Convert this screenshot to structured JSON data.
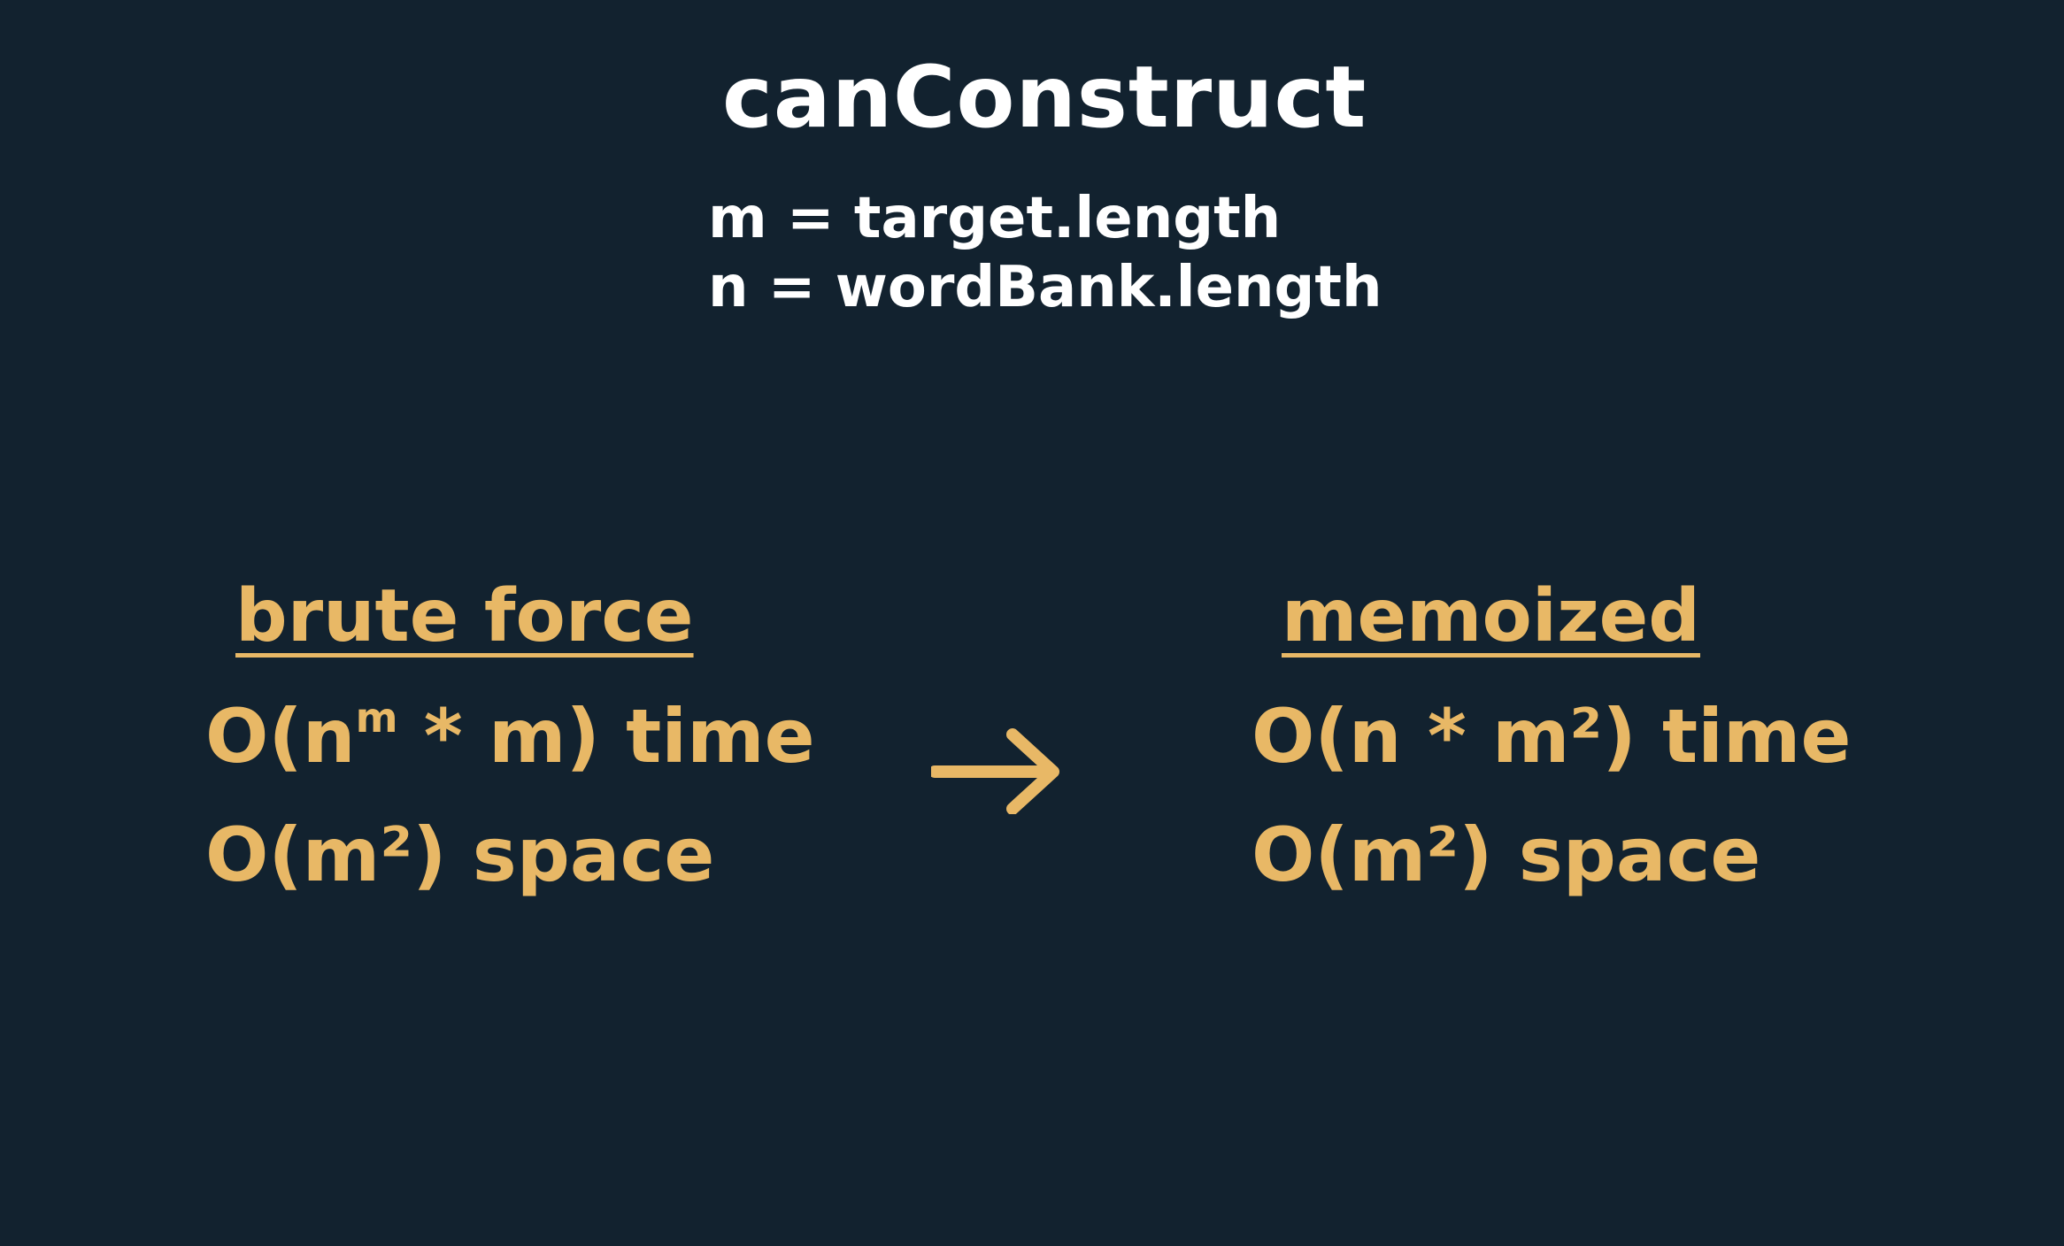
{
  "title": "canConstruct",
  "definitions": {
    "m": "m = target.length",
    "n": "n = wordBank.length"
  },
  "brute_force": {
    "heading": "brute force",
    "time_prefix": "O(n",
    "time_exponent": "m",
    "time_suffix": " * m) time",
    "space": "O(m²) space"
  },
  "memoized": {
    "heading": "memoized",
    "time": "O(n * m²) time",
    "space": "O(m²) space"
  },
  "arrow_icon": "right-arrow-icon",
  "colors": {
    "background": "#12222f",
    "title_text": "#ffffff",
    "accent": "#e8b866"
  }
}
